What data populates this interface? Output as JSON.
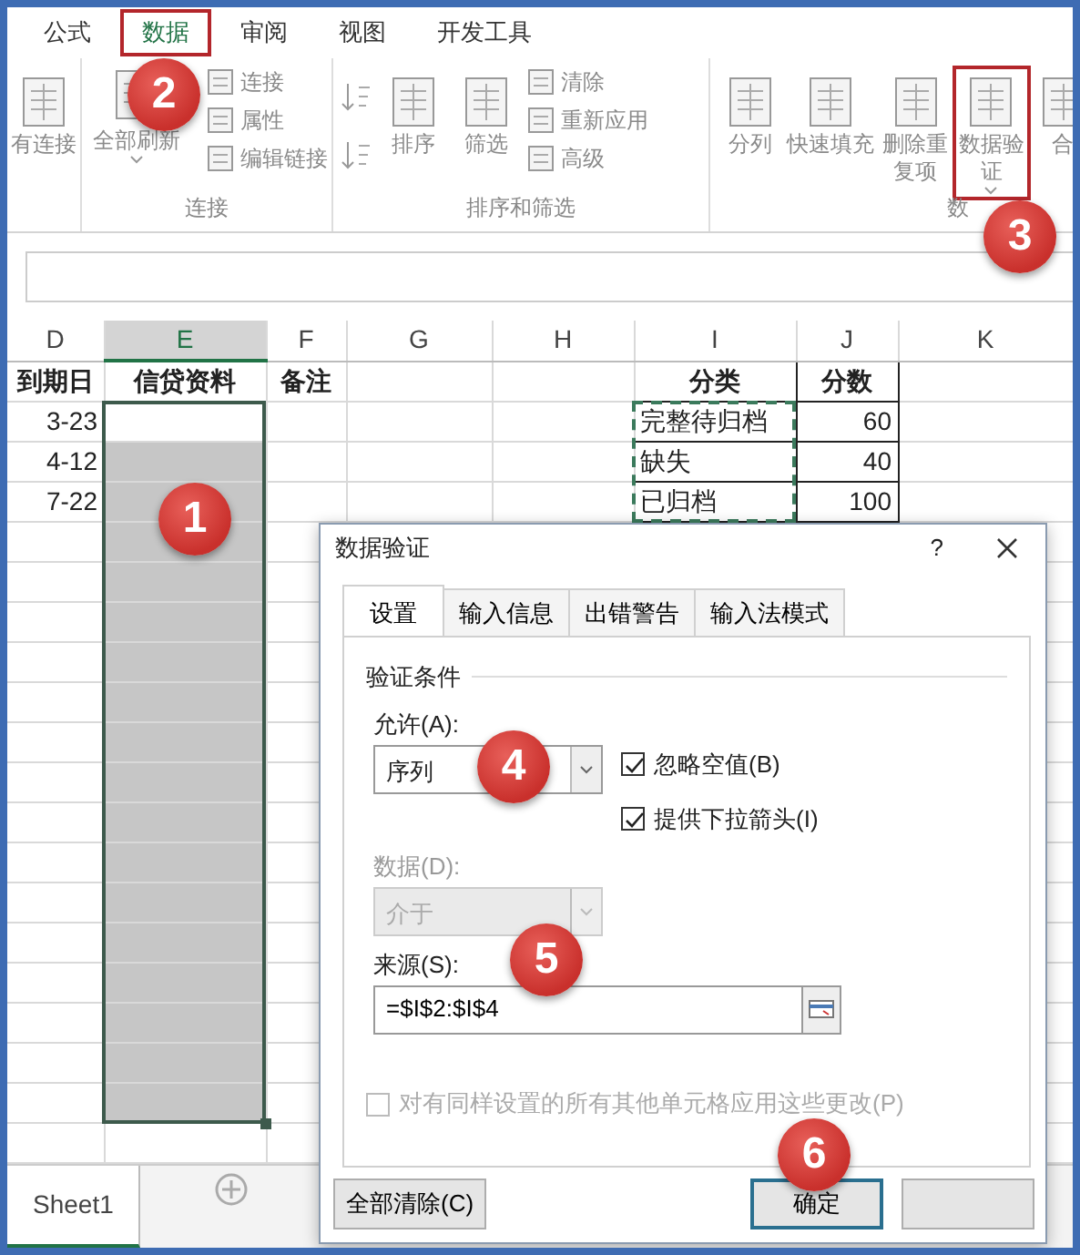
{
  "ribbon_tabs": [
    {
      "label": "公式",
      "selected": false,
      "highlighted": false
    },
    {
      "label": "数据",
      "selected": true,
      "highlighted": true
    },
    {
      "label": "审阅",
      "selected": false,
      "highlighted": false
    },
    {
      "label": "视图",
      "selected": false,
      "highlighted": false
    },
    {
      "label": "开发工具",
      "selected": false,
      "highlighted": false
    }
  ],
  "ribbon_groups": [
    {
      "items": [
        {
          "kind": "large",
          "label": "有连接"
        }
      ]
    },
    {
      "label": "连接",
      "items": [
        {
          "kind": "large",
          "label": "全部刷新",
          "dropdown": true
        },
        {
          "kind": "small",
          "label": "连接"
        },
        {
          "kind": "small",
          "label": "属性"
        },
        {
          "kind": "small",
          "label": "编辑链接"
        }
      ]
    },
    {
      "label": "排序和筛选",
      "items": [
        {
          "kind": "sort"
        },
        {
          "kind": "sort"
        },
        {
          "kind": "large",
          "label": "排序"
        },
        {
          "kind": "large",
          "label": "筛选"
        },
        {
          "kind": "small",
          "label": "清除"
        },
        {
          "kind": "small",
          "label": "重新应用"
        },
        {
          "kind": "small",
          "label": "高级"
        }
      ]
    },
    {
      "label": "数",
      "items": [
        {
          "kind": "large",
          "label": "分列"
        },
        {
          "kind": "large",
          "label": "快速填充"
        },
        {
          "kind": "large",
          "label": "删除重复项"
        },
        {
          "kind": "large",
          "label": "数据验证",
          "dropdown": true,
          "highlighted": true
        },
        {
          "kind": "large",
          "label": "合"
        }
      ]
    }
  ],
  "columns": [
    {
      "label": "D",
      "selected": false
    },
    {
      "label": "E",
      "selected": true
    },
    {
      "label": "F",
      "selected": false
    },
    {
      "label": "G",
      "selected": false
    },
    {
      "label": "H",
      "selected": false
    },
    {
      "label": "I",
      "selected": false
    },
    {
      "label": "J",
      "selected": false
    },
    {
      "label": "K",
      "selected": false
    }
  ],
  "rows": [
    {
      "kind": "header",
      "bordered": true,
      "in_selection": false,
      "copied": false,
      "d": "到期日",
      "e": "信贷资料",
      "f": "备注",
      "i": "分类",
      "j": "分数"
    },
    {
      "kind": "data",
      "bordered": true,
      "in_selection": true,
      "active": true,
      "copied": true,
      "d": "3-23",
      "i": "完整待归档",
      "j": "60"
    },
    {
      "kind": "data",
      "bordered": true,
      "in_selection": true,
      "copied": true,
      "d": "4-12",
      "i": "缺失",
      "j": "40"
    },
    {
      "kind": "data",
      "bordered": true,
      "in_selection": true,
      "copied": true,
      "d": "7-22",
      "i": "已归档",
      "j": "100"
    },
    {
      "kind": "data",
      "in_selection": true
    },
    {
      "kind": "data",
      "in_selection": true
    },
    {
      "kind": "data",
      "in_selection": true
    },
    {
      "kind": "data",
      "in_selection": true
    },
    {
      "kind": "data",
      "in_selection": true
    },
    {
      "kind": "data",
      "in_selection": true
    },
    {
      "kind": "data",
      "in_selection": true
    },
    {
      "kind": "data",
      "in_selection": true
    },
    {
      "kind": "data",
      "in_selection": true
    },
    {
      "kind": "data",
      "in_selection": true
    },
    {
      "kind": "data",
      "in_selection": true
    },
    {
      "kind": "data",
      "in_selection": true
    },
    {
      "kind": "data",
      "in_selection": true
    },
    {
      "kind": "data",
      "in_selection": true
    },
    {
      "kind": "data",
      "in_selection": true
    },
    {
      "kind": "data",
      "in_selection": false
    }
  ],
  "sheets": [
    {
      "label": "Sheet1",
      "selected": true
    }
  ],
  "dialog": {
    "title": "数据验证",
    "help": "?",
    "tabs": [
      {
        "label": "设置",
        "selected": true
      },
      {
        "label": "输入信息",
        "selected": false
      },
      {
        "label": "出错警告",
        "selected": false
      },
      {
        "label": "输入法模式",
        "selected": false
      }
    ],
    "section": "验证条件",
    "allow_label": "允许(A):",
    "allow_value": "序列",
    "checkboxes": [
      {
        "label": "忽略空值(B)",
        "checked": true
      },
      {
        "label": "提供下拉箭头(I)",
        "checked": true
      }
    ],
    "data_label": "数据(D):",
    "data_value": "介于",
    "data_disabled": true,
    "source_label": "来源(S):",
    "source_value": "=$I$2:$I$4",
    "apply_all": {
      "label": "对有同样设置的所有其他单元格应用这些更改(P)",
      "checked": false,
      "disabled": true
    },
    "buttons": [
      {
        "label": "全部清除(C)",
        "default": false
      },
      {
        "label": "确定",
        "default": true
      },
      {
        "default": false
      }
    ]
  },
  "callouts": [
    {
      "label": "1"
    },
    {
      "label": "2"
    },
    {
      "label": "3"
    },
    {
      "label": "4"
    },
    {
      "label": "5"
    },
    {
      "label": "6"
    }
  ]
}
